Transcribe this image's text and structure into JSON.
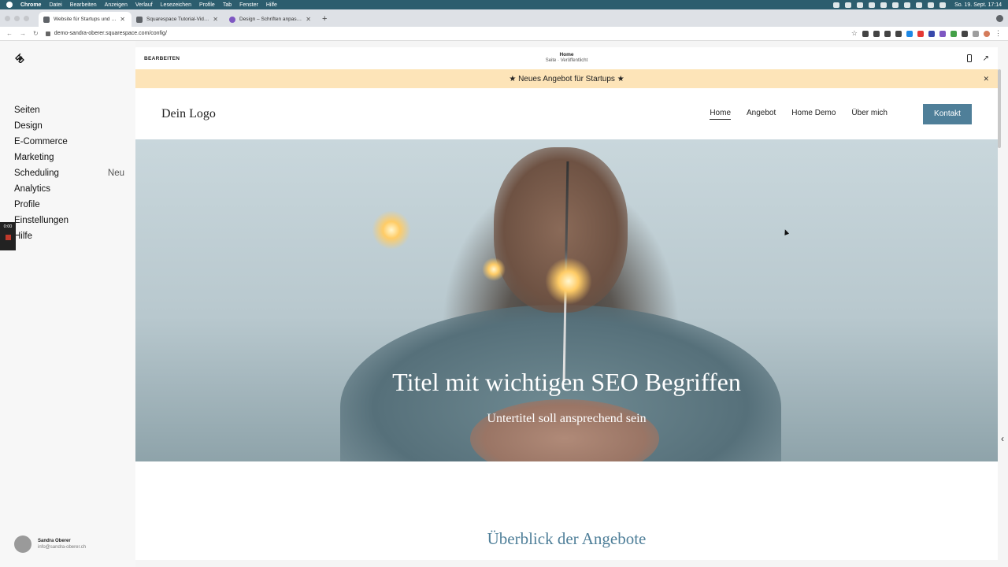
{
  "menubar": {
    "app": "Chrome",
    "items": [
      "Datei",
      "Bearbeiten",
      "Anzeigen",
      "Verlauf",
      "Lesezeichen",
      "Profile",
      "Tab",
      "Fenster",
      "Hilfe"
    ],
    "clock": "So. 19. Sept.  17:14"
  },
  "tabs": [
    {
      "label": "Website für Startups und KMU",
      "icon": "squarespace-icon"
    },
    {
      "label": "Squarespace Tutorial-Videos –",
      "icon": "squarespace-icon"
    },
    {
      "label": "Design – Schriften anpassen",
      "icon": "help-circle-icon"
    }
  ],
  "address": {
    "url": "demo-sandra-oberer.squarespace.com/config/"
  },
  "sidebar": {
    "items": [
      {
        "label": "Seiten",
        "badge": ""
      },
      {
        "label": "Design",
        "badge": ""
      },
      {
        "label": "E-Commerce",
        "badge": ""
      },
      {
        "label": "Marketing",
        "badge": ""
      },
      {
        "label": "Scheduling",
        "badge": "Neu"
      },
      {
        "label": "Analytics",
        "badge": ""
      },
      {
        "label": "Profile",
        "badge": ""
      },
      {
        "label": "Einstellungen",
        "badge": ""
      },
      {
        "label": "Hilfe",
        "badge": ""
      }
    ],
    "user": {
      "name": "Sandra Oberer",
      "email": "info@sandra-oberer.ch"
    },
    "recorder_time": "0:00"
  },
  "editor": {
    "edit_label": "BEARBEITEN",
    "page_title": "Home",
    "page_status": "Seite · Veröffentlicht"
  },
  "site": {
    "announcement": "★  Neues Angebot für Startups  ★",
    "logo": "Dein Logo",
    "nav": [
      "Home",
      "Angebot",
      "Home Demo",
      "Über mich"
    ],
    "cta": "Kontakt",
    "hero_title": "Titel mit wichtigen SEO Begriffen",
    "hero_subtitle": "Untertitel soll ansprechend sein",
    "section_title": "Überblick der Angebote"
  },
  "colors": {
    "menubar": "#2c5d6e",
    "accent": "#4f7f99",
    "announcement_bg": "#fde4b8"
  }
}
